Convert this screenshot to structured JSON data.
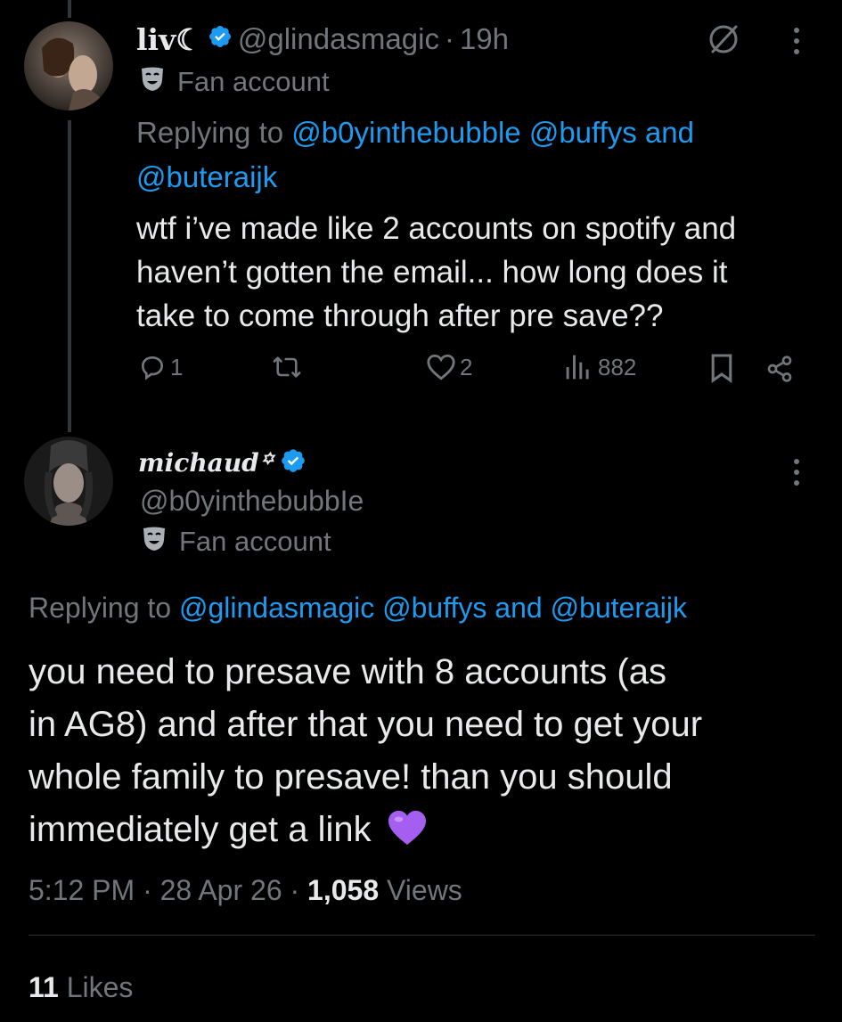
{
  "tweet1": {
    "display_name": "liv☾",
    "handle": "@glindasmagic",
    "separator": "·",
    "time": "19h",
    "label": "Fan account",
    "replying_prefix": "Replying to",
    "replying_mention1": "@b0yinthebubble",
    "replying_mention2": "@buffys",
    "replying_and": "and",
    "replying_mention3": "@buteraijk",
    "text_line1": "wtf i’ve made like 2 accounts on spotify and",
    "text_line2": "haven’t gotten the email... how long does it",
    "text_line3": "take to come through after pre save??",
    "replies": "1",
    "likes": "2",
    "views": "882"
  },
  "tweet2": {
    "display_name": "michaud꙳",
    "handle": "@b0yinthebubbIe",
    "label": "Fan account",
    "replying_prefix": "Replying to",
    "replying_mention1": "@glindasmagic",
    "replying_mention2": "@buffys",
    "replying_and": "and",
    "replying_mention3": "@buteraijk",
    "text_line1": "you need to presave with 8 accounts (as",
    "text_line2": "in AG8) and after that you need to get your",
    "text_line3": "whole family to presave! than you should",
    "text_line4": "immediately get a link",
    "emoji": "💜",
    "time": "5:12 PM",
    "sep1": "·",
    "date": "28 Apr 26",
    "sep2": "·",
    "views_count": "1,058",
    "views_label": "Views",
    "likes_count": "11",
    "likes_label": "Likes"
  },
  "colors": {
    "background": "#000000",
    "text": "#e7e9ea",
    "secondary": "#71767b",
    "link": "#1d9bf0",
    "verified": "#1d9bf0",
    "divider": "#2f3336"
  }
}
